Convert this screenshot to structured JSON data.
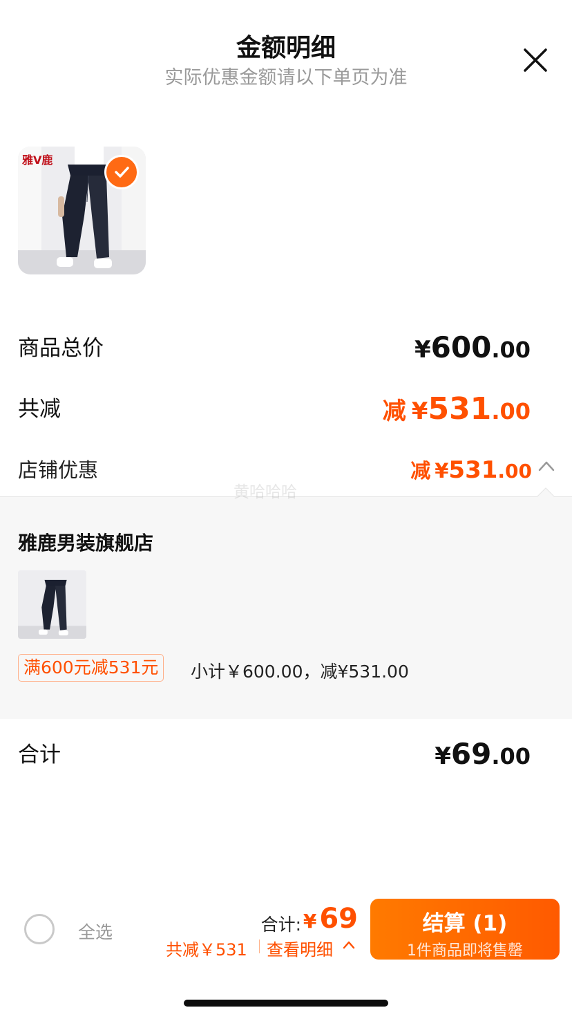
{
  "header": {
    "title": "金额明细",
    "subtitle": "实际优惠金额请以下单页为准",
    "close_icon": "close-icon"
  },
  "product": {
    "brand_logo": "雅V鹿",
    "selected": true
  },
  "summary": {
    "total_label": "商品总价",
    "total_symbol": "¥",
    "total_int": "600",
    "total_dec": ".00",
    "reduce_label": "共减",
    "reduce_word": "减",
    "reduce_symbol": "¥",
    "reduce_int": "531",
    "reduce_dec": ".00",
    "shop_discount_label": "店铺优惠",
    "shop_discount_word": "减",
    "shop_discount_symbol": "¥",
    "shop_discount_int": "531",
    "shop_discount_dec": ".00",
    "sum_label": "合计",
    "sum_symbol": "¥",
    "sum_int": "69",
    "sum_dec": ".00"
  },
  "detail": {
    "shop_name": "雅鹿男装旗舰店",
    "promo_tag": "满600元减531元",
    "subtotal": "小计￥600.00，减¥531.00"
  },
  "watermark": "黄哈哈哈",
  "bottom_bar": {
    "select_all": "全选",
    "total_label": "合计:",
    "total_symbol": "¥",
    "total_int": "69",
    "reduce_text": "共减￥531",
    "view_detail": "查看明细",
    "checkout_label": "结算 (1)",
    "checkout_sub": "1件商品即将售罄"
  },
  "colors": {
    "accent": "#ff5000",
    "button_gradient_start": "#ff7a00",
    "button_gradient_end": "#ff5a00",
    "panel_bg": "#f7f7f7",
    "muted": "#9a9a9a"
  }
}
